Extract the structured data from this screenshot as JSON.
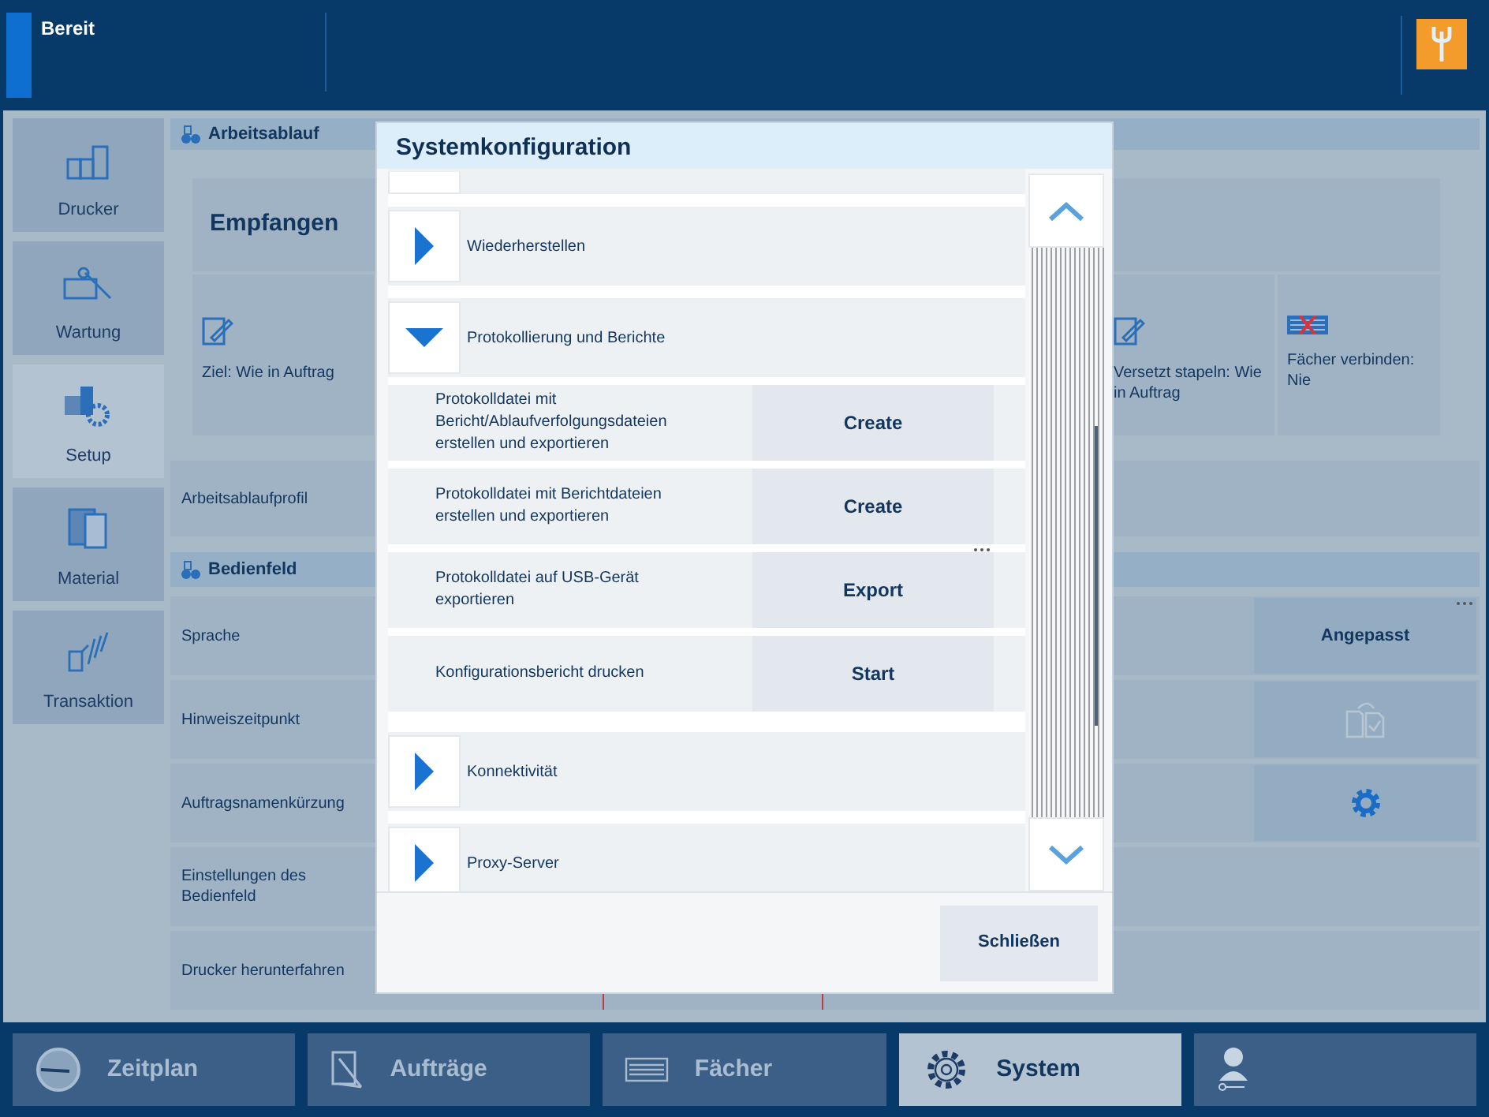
{
  "header": {
    "status": "Bereit"
  },
  "nav": [
    {
      "label": "Drucker",
      "kind": "printer",
      "selected": false
    },
    {
      "label": "Wartung",
      "kind": "maintenance",
      "selected": false
    },
    {
      "label": "Setup",
      "kind": "setup",
      "selected": true
    },
    {
      "label": "Material",
      "kind": "material",
      "selected": false
    },
    {
      "label": "Transaktion",
      "kind": "transaction",
      "selected": false
    }
  ],
  "workflow": {
    "title": "Arbeitsablauf",
    "card_title": "Empfangen",
    "tiles": [
      {
        "label": "Ziel: Wie in Auftrag",
        "kind": "edit"
      },
      {
        "label": "Versetzt stapeln: Wie in Auftrag",
        "kind": "edit"
      },
      {
        "label": "Fächer verbinden: Nie",
        "kind": "link-trays"
      }
    ],
    "profile": "Arbeitsablaufprofil"
  },
  "panel": {
    "title": "Bedienfeld",
    "rows": [
      {
        "label": "Sprache",
        "kind": "text",
        "value": "Angepasst",
        "more": true
      },
      {
        "label": "Hinweiszeitpunkt",
        "kind": "docs",
        "more": false
      },
      {
        "label": "Auftragsnamenkürzung",
        "kind": "gear",
        "more": false
      },
      {
        "label": "Einstellungen des Bedienfeld",
        "kind": "none"
      },
      {
        "label": "Drucker herunterfahren",
        "kind": "field"
      }
    ]
  },
  "dialog": {
    "title": "Systemkonfiguration",
    "groups": [
      {
        "label": "Wiederherstellen",
        "expanded": false
      },
      {
        "label": "Protokollierung und Berichte",
        "expanded": true,
        "actions": [
          {
            "label": "Protokolldatei mit Bericht/Ablaufverfolgungsdateien erstellen und exportieren",
            "button": "Create",
            "more": false
          },
          {
            "label": "Protokolldatei mit Berichtdateien erstellen und exportieren",
            "button": "Create",
            "more": false
          },
          {
            "label": "Protokolldatei auf USB-Gerät exportieren",
            "button": "Export",
            "more": true
          },
          {
            "label": "Konfigurationsbericht drucken",
            "button": "Start",
            "more": false
          }
        ]
      },
      {
        "label": "Konnektivität",
        "expanded": false
      },
      {
        "label": "Proxy-Server",
        "expanded": false
      }
    ],
    "close": "Schließen"
  },
  "taskbar": [
    {
      "label": "Zeitplan",
      "kind": "clock",
      "selected": false
    },
    {
      "label": "Aufträge",
      "kind": "jobs",
      "selected": false
    },
    {
      "label": "Fächer",
      "kind": "trays",
      "selected": false
    },
    {
      "label": "System",
      "kind": "gear",
      "selected": true
    },
    {
      "kind": "user",
      "selected": false
    }
  ]
}
